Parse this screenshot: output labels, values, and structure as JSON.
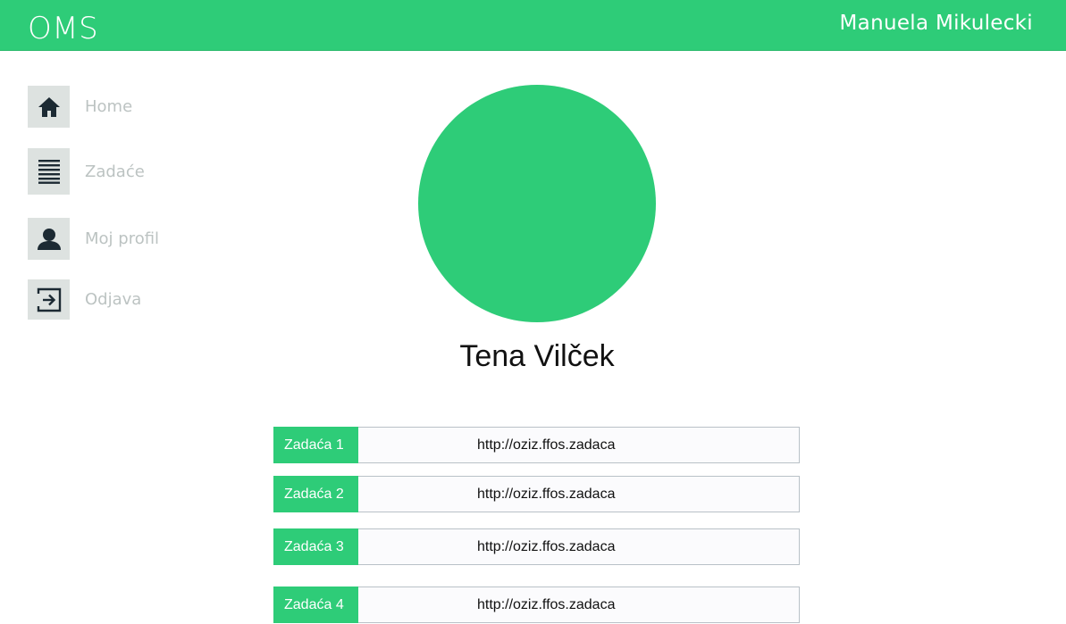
{
  "header": {
    "brand": "OMS",
    "user_name": "Manuela Mikulecki"
  },
  "sidebar": {
    "items": [
      {
        "label": "Home",
        "icon": "home-icon"
      },
      {
        "label": "Zadaće",
        "icon": "list-icon"
      },
      {
        "label": "Moj profil",
        "icon": "user-icon"
      },
      {
        "label": "Odjava",
        "icon": "logout-icon"
      }
    ]
  },
  "profile": {
    "name": "Tena Vilček"
  },
  "assignments": [
    {
      "label": "Zadaća 1",
      "link": "http://oziz.ffos.zadaca"
    },
    {
      "label": "Zadaća 2",
      "link": "http://oziz.ffos.zadaca"
    },
    {
      "label": "Zadaća 3",
      "link": "http://oziz.ffos.zadaca"
    },
    {
      "label": "Zadaća 4",
      "link": "http://oziz.ffos.zadaca"
    }
  ],
  "colors": {
    "accent": "#2ecc78",
    "nav_icon_bg": "#dde2e0",
    "nav_label": "#bcc3c2"
  }
}
